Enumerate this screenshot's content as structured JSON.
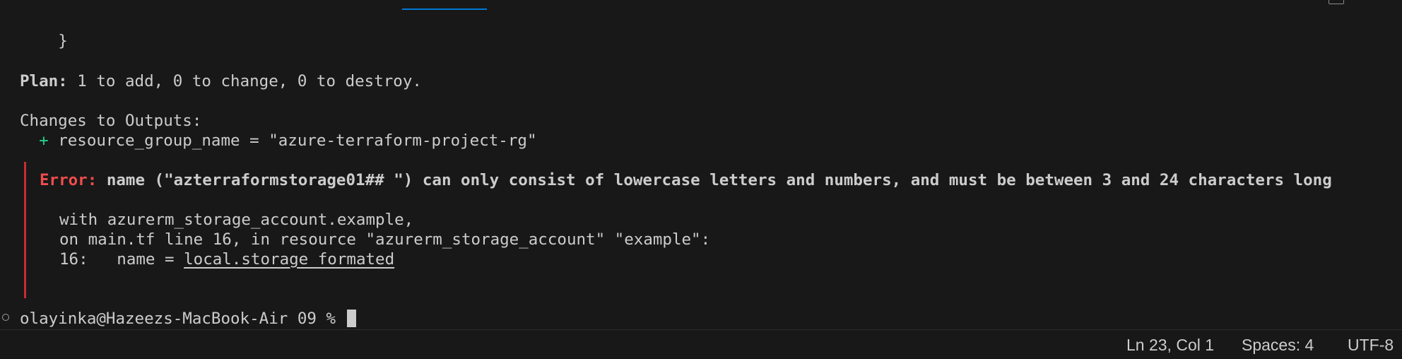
{
  "terminal": {
    "closing_brace": "}",
    "plan": {
      "label": "Plan:",
      "text": " 1 to add, 0 to change, 0 to destroy."
    },
    "outputs_header": "Changes to Outputs:",
    "output_change": {
      "symbol": "+",
      "text": "resource_group_name = \"azure-terraform-project-rg\""
    },
    "error": {
      "label": "Error:",
      "message": "name (\"azterraformstorage01## \") can only consist of lowercase letters and numbers, and must be between 3 and 24 characters long",
      "with_line": "with azurerm_storage_account.example,",
      "on_line": "on main.tf line 16, in resource \"azurerm_storage_account\" \"example\":",
      "code_prefix": "16:   name = ",
      "code_ref": "local.storage_formated"
    },
    "prompt": "olayinka@Hazeezs-MacBook-Air 09 % "
  },
  "statusbar": {
    "cursor_position": "Ln 23, Col 1",
    "indentation": "Spaces: 4",
    "encoding": "UTF-8"
  },
  "colors": {
    "background": "#181818",
    "foreground": "#cccccc",
    "error": "#f14c4c",
    "error_bar": "#c72e2e",
    "added": "#23d18b",
    "active_tab": "#0078d4"
  }
}
